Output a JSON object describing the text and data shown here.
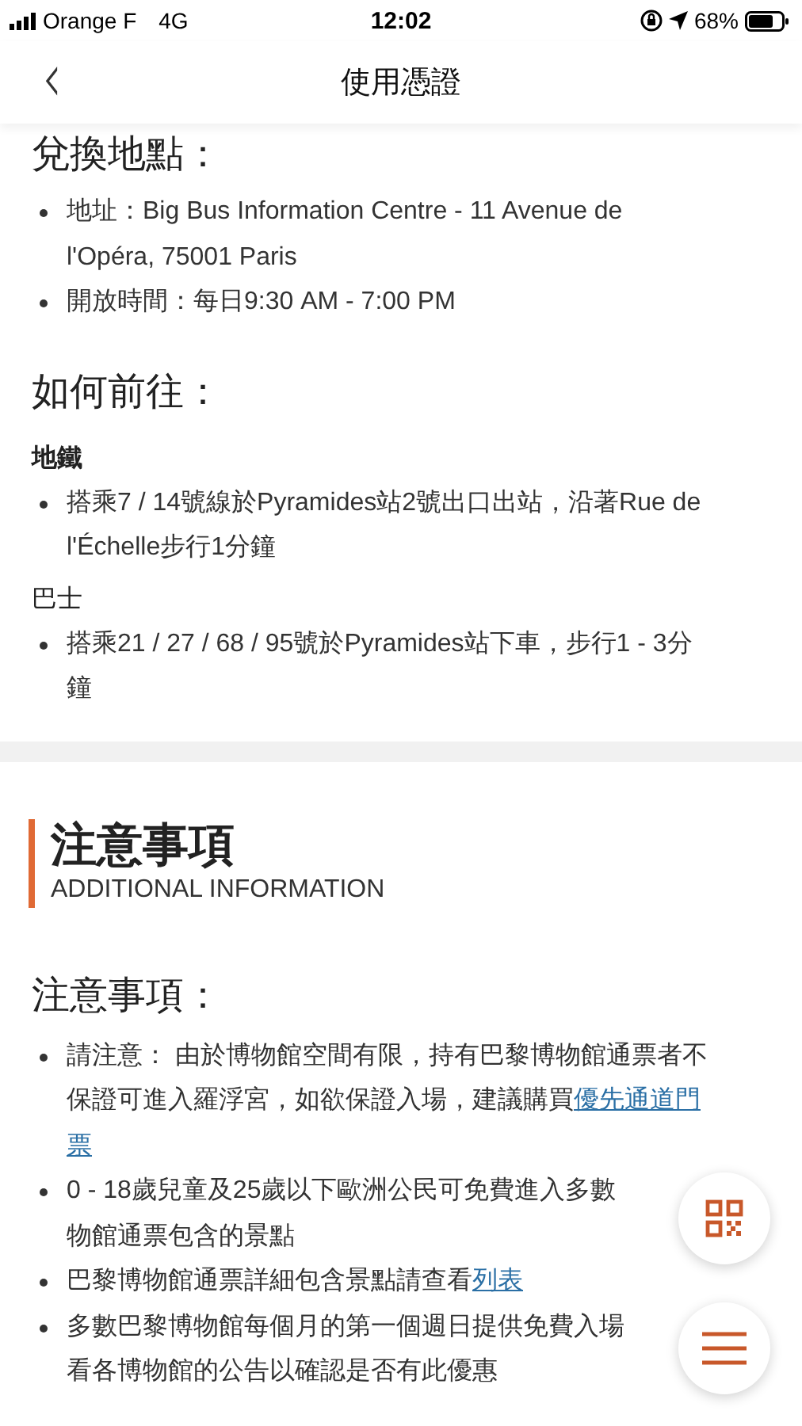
{
  "status_bar": {
    "carrier": "Orange F",
    "network": "4G",
    "time": "12:02",
    "battery": "68%"
  },
  "nav_bar": {
    "back": "‹",
    "title": "使用憑證"
  },
  "redemption": {
    "heading": "兌換地點：",
    "items": [
      {
        "lines": [
          [
            {
              "text": "地址：Big Bus Information Centre - 11 Avenue de"
            }
          ],
          [
            {
              "text": "l'Opéra, 75001 Paris"
            }
          ]
        ]
      },
      {
        "lines": [
          [
            {
              "text": "開放時間：每日9:30 AM - 7:00 PM"
            }
          ]
        ]
      }
    ]
  },
  "directions": {
    "heading": "如何前往：",
    "groups": [
      {
        "label": "地鐵",
        "bold": true,
        "items": [
          {
            "lines": [
              [
                {
                  "text": "搭乘7 / 14號線於Pyramides站2號出口出站，沿著Rue de"
                }
              ],
              [
                {
                  "text": "l'Échelle步行1分鐘"
                }
              ]
            ]
          }
        ]
      },
      {
        "label": "巴士",
        "bold": false,
        "items": [
          {
            "lines": [
              [
                {
                  "text": "搭乘21 / 27 / 68 / 95號於Pyramides站下車，步行1 - 3分"
                }
              ],
              [
                {
                  "text": "鐘"
                }
              ]
            ]
          }
        ]
      }
    ]
  },
  "additional": {
    "title": "注意事項",
    "subtitle": "ADDITIONAL INFORMATION",
    "heading": "注意事項：",
    "items": [
      {
        "lines": [
          [
            {
              "text": "請注意： 由於博物館空間有限，持有巴黎博物館通票者不"
            }
          ],
          [
            {
              "text": "保證可進入羅浮宮，如欲保證入場，建議購買"
            },
            {
              "text": "優先通道門",
              "link": true
            }
          ],
          [
            {
              "text": "票",
              "link": true
            }
          ]
        ]
      },
      {
        "lines": [
          [
            {
              "text": "0 - 18歲兒童及25歲以下歐洲公民可免費進入多數"
            }
          ],
          [
            {
              "text": "物館通票包含的景點"
            }
          ]
        ]
      },
      {
        "lines": [
          [
            {
              "text": "巴黎博物館通票詳細包含景點請查看"
            },
            {
              "text": "列表",
              "link": true
            }
          ]
        ]
      },
      {
        "lines": [
          [
            {
              "text": "多數巴黎博物館每個月的第一個週日提供免費入場"
            }
          ],
          [
            {
              "text": "看各博物館的公告以確認是否有此優惠"
            }
          ]
        ]
      }
    ]
  },
  "floating_buttons": [
    {
      "kind": "qr"
    },
    {
      "kind": "menu"
    }
  ]
}
